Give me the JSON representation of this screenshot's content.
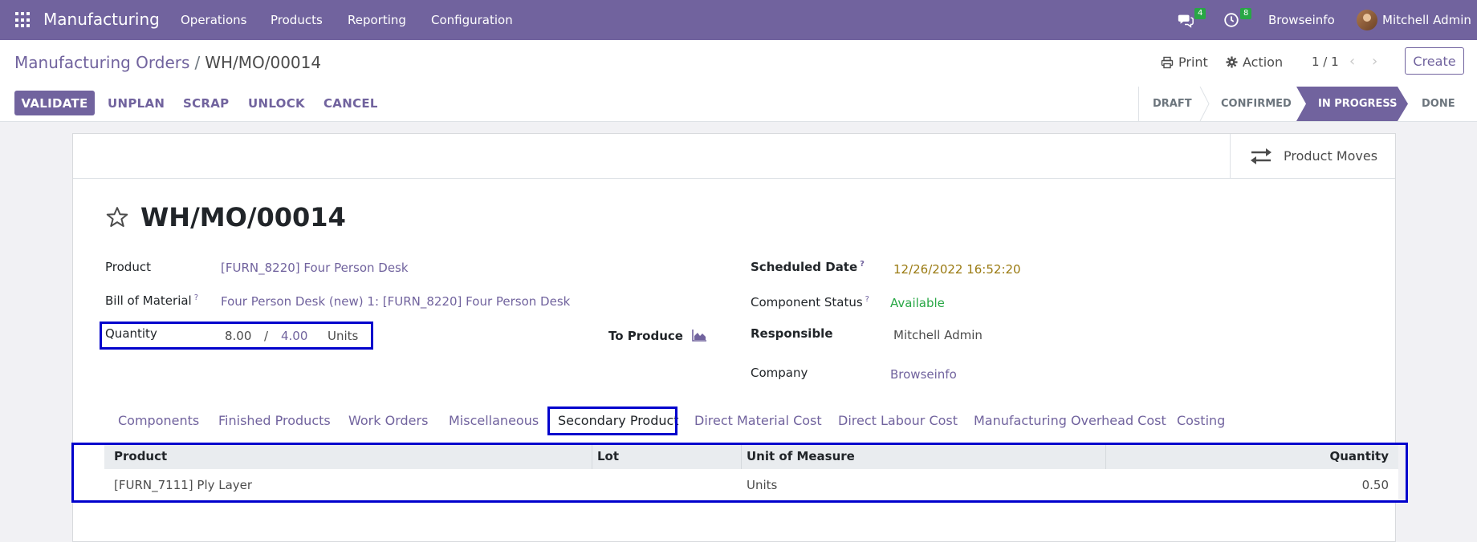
{
  "navbar": {
    "app_name": "Manufacturing",
    "menus": [
      "Operations",
      "Products",
      "Reporting",
      "Configuration"
    ],
    "messages_count": "4",
    "activities_count": "8",
    "company": "Browseinfo",
    "user": "Mitchell Admin"
  },
  "control_panel": {
    "breadcrumb_parent": "Manufacturing Orders",
    "breadcrumb_separator": "/",
    "breadcrumb_current": "WH/MO/00014",
    "print_label": "Print",
    "action_label": "Action",
    "pager": "1 / 1",
    "create_label": "Create"
  },
  "statusbar": {
    "buttons": [
      "VALIDATE",
      "UNPLAN",
      "SCRAP",
      "UNLOCK",
      "CANCEL"
    ],
    "stages": [
      "DRAFT",
      "CONFIRMED",
      "IN PROGRESS",
      "DONE"
    ],
    "active_stage": "IN PROGRESS"
  },
  "sheet": {
    "smart_button_label": "Product Moves",
    "title": "WH/MO/00014",
    "fields": {
      "product_label": "Product",
      "product_value": "[FURN_8220] Four Person Desk",
      "bom_label": "Bill of Material",
      "bom_value": "Four Person Desk (new) 1: [FURN_8220] Four Person Desk",
      "quantity_label": "Quantity",
      "quantity_produced": "8.00",
      "quantity_sep": "/",
      "quantity_total": "4.00",
      "quantity_uom": "Units",
      "to_produce_label": "To Produce",
      "scheduled_date_label": "Scheduled Date",
      "scheduled_date_value": "12/26/2022 16:52:20",
      "component_status_label": "Component Status",
      "component_status_value": "Available",
      "responsible_label": "Responsible",
      "responsible_value": "Mitchell Admin",
      "company_label": "Company",
      "company_value": "Browseinfo",
      "help_mark": "?"
    },
    "tabs": [
      "Components",
      "Finished Products",
      "Work Orders",
      "Miscellaneous",
      "Secondary Product",
      "Direct Material Cost",
      "Direct Labour Cost",
      "Manufacturing Overhead Cost",
      "Costing"
    ],
    "active_tab": "Secondary Product",
    "table": {
      "headers": [
        "Product",
        "Lot",
        "Unit of Measure",
        "Quantity"
      ],
      "rows": [
        {
          "product": "[FURN_7111] Ply Layer",
          "lot": "",
          "uom": "Units",
          "quantity": "0.50"
        }
      ]
    }
  },
  "colors": {
    "brand": "#71639e",
    "highlight_box": "#0000cc",
    "badge": "#28a745",
    "available": "#28a745",
    "date": "#9a7a11"
  }
}
